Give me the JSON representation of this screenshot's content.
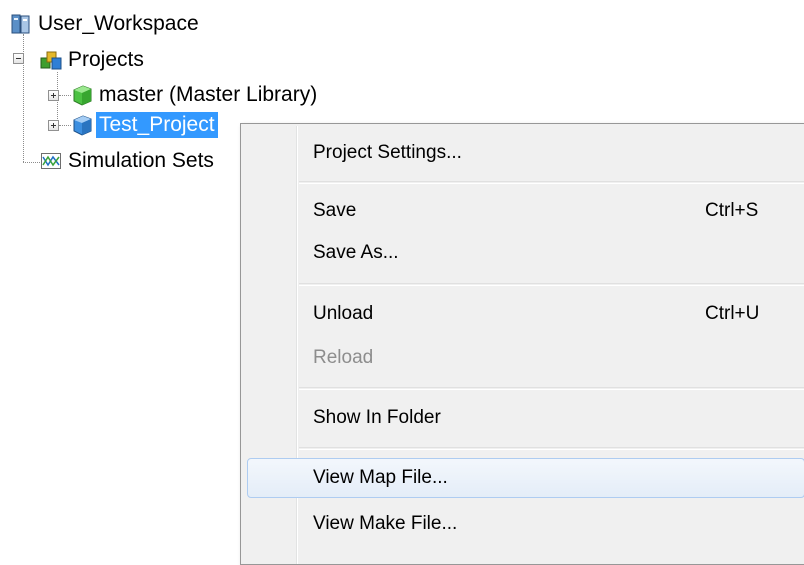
{
  "tree": {
    "workspace": "User_Workspace",
    "projects": "Projects",
    "master": "master (Master Library)",
    "test_project": "Test_Project",
    "simulation_sets": "Simulation Sets"
  },
  "menu": {
    "project_settings": "Project Settings...",
    "save": "Save",
    "save_shortcut": "Ctrl+S",
    "save_as": "Save As...",
    "unload": "Unload",
    "unload_shortcut": "Ctrl+U",
    "reload": "Reload",
    "show_in_folder": "Show In Folder",
    "view_map_file": "View Map File...",
    "view_make_file": "View Make File..."
  },
  "colors": {
    "selection": "#3399ff",
    "menu_bg": "#f0f0f0",
    "hover_border": "#aeccf1",
    "disabled_text": "#8d8d8d"
  },
  "icons": {
    "workspace": "workspace-icon",
    "projects": "projects-icon",
    "master": "library-cube-icon",
    "test_project": "project-cube-icon",
    "simulation_sets": "simulation-chart-icon"
  }
}
